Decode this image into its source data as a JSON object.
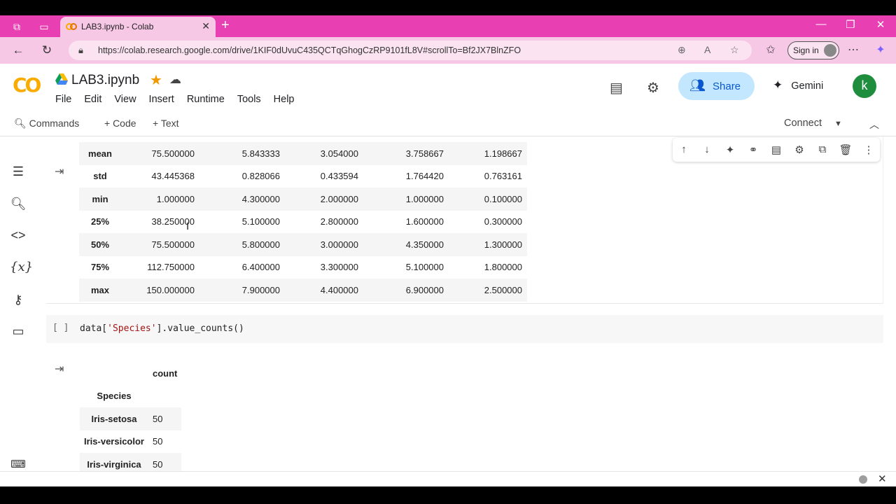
{
  "browser": {
    "tab_title": "LAB3.ipynb - Colab",
    "url": "https://colab.research.google.com/drive/1KIF0dUvuC435QCTqGhogCzRP9101fL8V#scrollTo=Bf2JX7BlnZFO",
    "signin_label": "Sign in",
    "accent": "#e83fb2"
  },
  "header": {
    "logo_text": "CO",
    "notebook_title": "LAB3.ipynb",
    "menu": [
      "File",
      "Edit",
      "View",
      "Insert",
      "Runtime",
      "Tools",
      "Help"
    ],
    "share_label": "Share",
    "gemini_label": "Gemini",
    "avatar_letter": "k"
  },
  "toolbar": {
    "commands_label": "Commands",
    "code_label": "+ Code",
    "text_label": "+ Text",
    "connect_label": "Connect"
  },
  "describe_table": {
    "rows": [
      {
        "index": "mean",
        "values": [
          "75.500000",
          "5.843333",
          "3.054000",
          "3.758667",
          "1.198667"
        ]
      },
      {
        "index": "std",
        "values": [
          "43.445368",
          "0.828066",
          "0.433594",
          "1.764420",
          "0.763161"
        ]
      },
      {
        "index": "min",
        "values": [
          "1.000000",
          "4.300000",
          "2.000000",
          "1.000000",
          "0.100000"
        ]
      },
      {
        "index": "25%",
        "values": [
          "38.250000",
          "5.100000",
          "2.800000",
          "1.600000",
          "0.300000"
        ]
      },
      {
        "index": "50%",
        "values": [
          "75.500000",
          "5.800000",
          "3.000000",
          "4.350000",
          "1.300000"
        ]
      },
      {
        "index": "75%",
        "values": [
          "112.750000",
          "6.400000",
          "3.300000",
          "5.100000",
          "1.800000"
        ]
      },
      {
        "index": "max",
        "values": [
          "150.000000",
          "7.900000",
          "4.400000",
          "6.900000",
          "2.500000"
        ]
      }
    ]
  },
  "code_cell": {
    "brackets": "[ ]",
    "code_prefix": "data[",
    "code_string": "'Species'",
    "code_suffix": "].value_counts()"
  },
  "value_counts": {
    "column_header": "count",
    "index_name": "Species",
    "rows": [
      {
        "index": "Iris-setosa",
        "count": "50"
      },
      {
        "index": "Iris-versicolor",
        "count": "50"
      },
      {
        "index": "Iris-virginica",
        "count": "50"
      }
    ]
  }
}
